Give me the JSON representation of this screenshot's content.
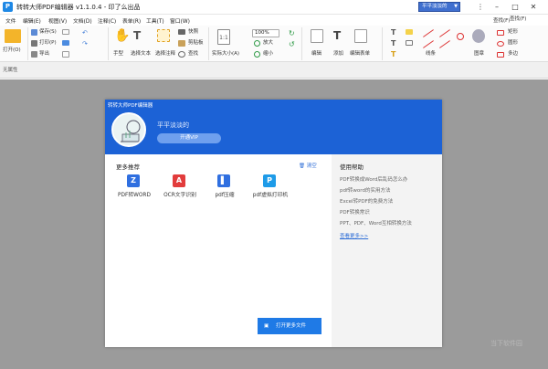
{
  "window": {
    "title": "转转大师PDF编辑器 v1.1.0.4 - 印了么出品",
    "app_icon_letter": "P",
    "user_dropdown": "平平淡淡的",
    "dropdown_arrow": "▼"
  },
  "menu": [
    "文件",
    "编辑(E)",
    "视图(V)",
    "文档(D)",
    "注释(C)",
    "表单(R)",
    "工具(T)",
    "窗口(W)"
  ],
  "toolbar": {
    "open": "打开(O)",
    "save": "保存(S)",
    "print": "打印(P)",
    "export": "导出",
    "hand": "手型",
    "select_text": "选择文本",
    "select_annot": "选择注释",
    "snapshot": "快照",
    "clipboard": "剪贴板",
    "find": "查找",
    "actual_size": "实际大小(A)",
    "zoom_value": "100%",
    "zoom_in": "放大",
    "zoom_out": "缩小",
    "edit": "编辑",
    "add": "添加",
    "edit_form": "编辑表单",
    "line": "线条",
    "stamp": "图章",
    "find_right": "查找(F)",
    "search_right": "搜索(S)",
    "rect": "矩形",
    "ellipse": "圆形",
    "polygon": "多边",
    "search_placeholder": "查找..."
  },
  "subbar_label": "无属性",
  "panel": {
    "app_title": "转转大师PDF编辑器",
    "username": "平平淡淡的",
    "vip_button": "开通VIP",
    "recommend_title": "更多推荐",
    "clear": "清空",
    "tools": [
      {
        "label": "PDF转WORD",
        "icon": "word-icon",
        "color": "#2f6fe0",
        "glyph": "Z"
      },
      {
        "label": "OCR文字识别",
        "icon": "ocr-icon",
        "color": "#e23c3c",
        "glyph": "A"
      },
      {
        "label": "pdf压缩",
        "icon": "compress-icon",
        "color": "#2f6fe0",
        "glyph": "▌"
      },
      {
        "label": "pdf虚拟打印机",
        "icon": "printer-icon",
        "color": "#1e9be8",
        "glyph": "P"
      }
    ],
    "open_more": "打开更多文件",
    "help_title": "使用帮助",
    "help_items": [
      "PDF转换成Word后乱码怎么办",
      "pdf转word的实用方法",
      "Excel转PDF的免费方法",
      "PDF转换常识",
      "PPT、PDF、Word互相转换方法"
    ],
    "see_more": "查看更多>>"
  },
  "watermark": "当下软件园"
}
